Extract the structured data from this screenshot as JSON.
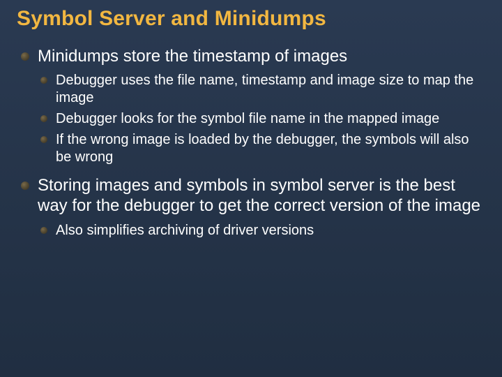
{
  "title": "Symbol Server and Minidumps",
  "bullets": [
    {
      "text": "Minidumps store the timestamp of images",
      "children": [
        "Debugger uses the file name, timestamp and image size to map the image",
        "Debugger looks for the symbol file name in the mapped image",
        "If the wrong image is loaded by the debugger, the symbols will also be wrong"
      ]
    },
    {
      "text": "Storing images and symbols in symbol server is the best way for the debugger to get the correct version of the image",
      "children": [
        "Also simplifies archiving of driver versions"
      ]
    }
  ]
}
